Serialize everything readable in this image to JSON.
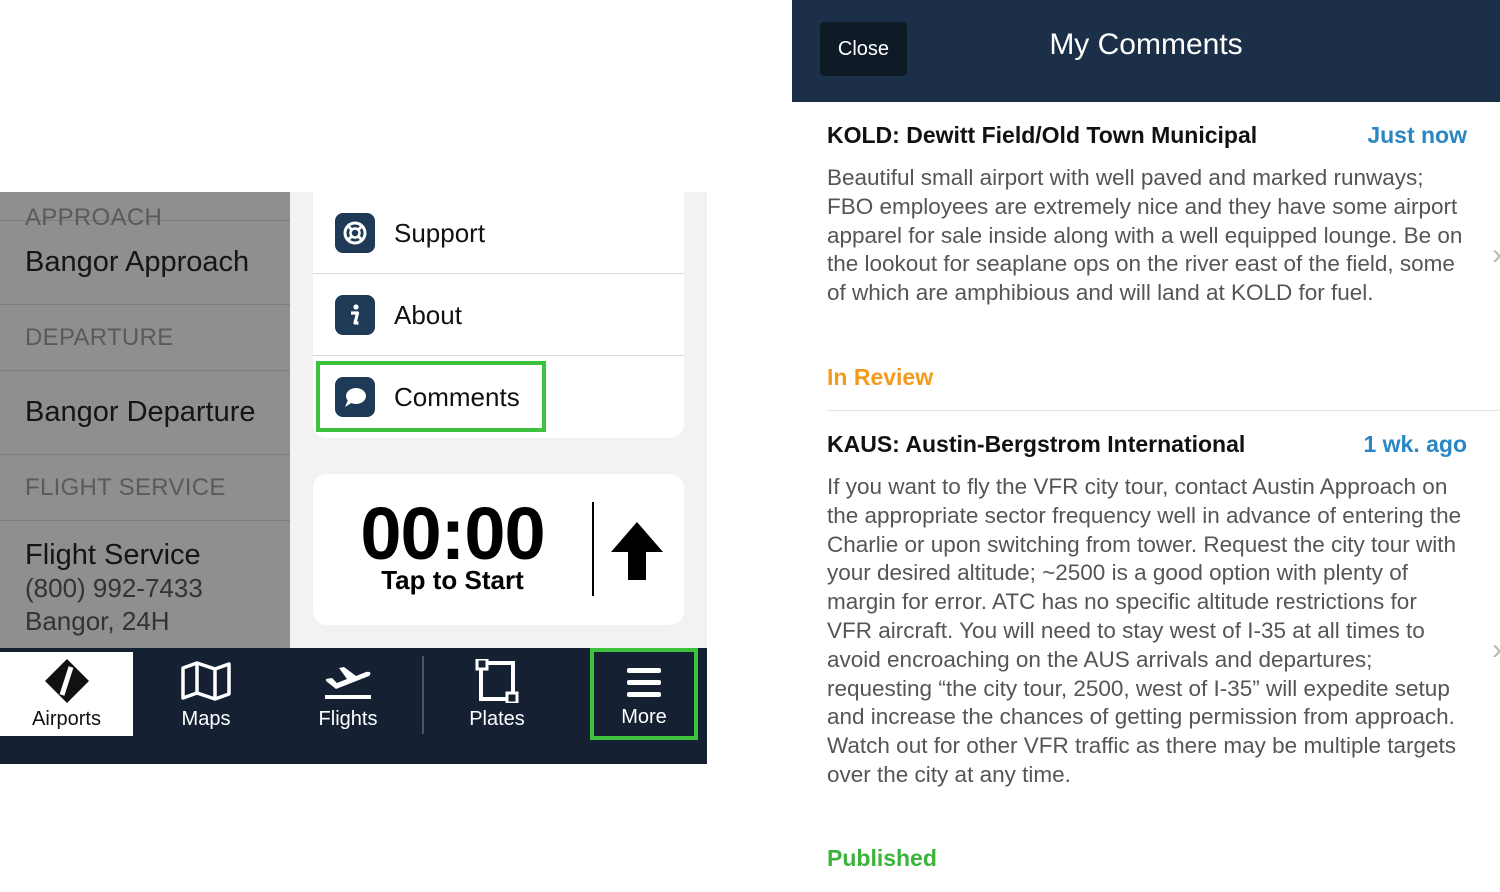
{
  "left": {
    "frequencies": {
      "approach_section": "APPROACH",
      "approach_item": "Bangor Approach",
      "departure_section": "DEPARTURE",
      "departure_item": "Bangor Departure",
      "flight_service_section": "FLIGHT SERVICE",
      "flight_service_item": "Flight Service",
      "flight_service_phone": "(800) 992-7433",
      "flight_service_info": "Bangor, 24H"
    },
    "more_menu": {
      "support": "Support",
      "about": "About",
      "comments": "Comments"
    },
    "timer": {
      "time": "00:00",
      "caption": "Tap to Start"
    },
    "tabs": {
      "airports": "Airports",
      "maps": "Maps",
      "flights": "Flights",
      "plates": "Plates",
      "more": "More"
    },
    "highlight_color": "#3cc23c"
  },
  "right": {
    "close_label": "Close",
    "title": "My Comments",
    "comments": [
      {
        "airport": "KOLD: Dewitt Field/Old Town Municipal",
        "time": "Just now",
        "text": "Beautiful small airport with well paved and marked runways; FBO employees are extremely nice and they have some airport apparel for sale inside along with a well equipped lounge. Be on the lookout for seaplane ops on the river east of the field, some of which are amphibious and will land at KOLD for fuel.",
        "status": "In Review",
        "status_color": "#f39a1b"
      },
      {
        "airport": "KAUS: Austin-Bergstrom International",
        "time": "1 wk. ago",
        "text": "If you want to fly the VFR city tour, contact Austin Approach on the appropriate sector frequency well in advance of entering the Charlie or upon switching from tower. Request the city tour with your desired altitude; ~2500 is a good option with plenty of margin for error. ATC has no specific altitude restrictions for VFR aircraft. You will need to stay west of I-35 at all times to avoid encroaching on the AUS arrivals and departures; requesting “the city tour, 2500, west of I-35” will expedite setup and increase the chances of getting permission from approach. Watch out for other VFR traffic as there may be multiple targets over the city at any time.",
        "status": "Published",
        "status_color": "#3cb43c"
      }
    ]
  }
}
